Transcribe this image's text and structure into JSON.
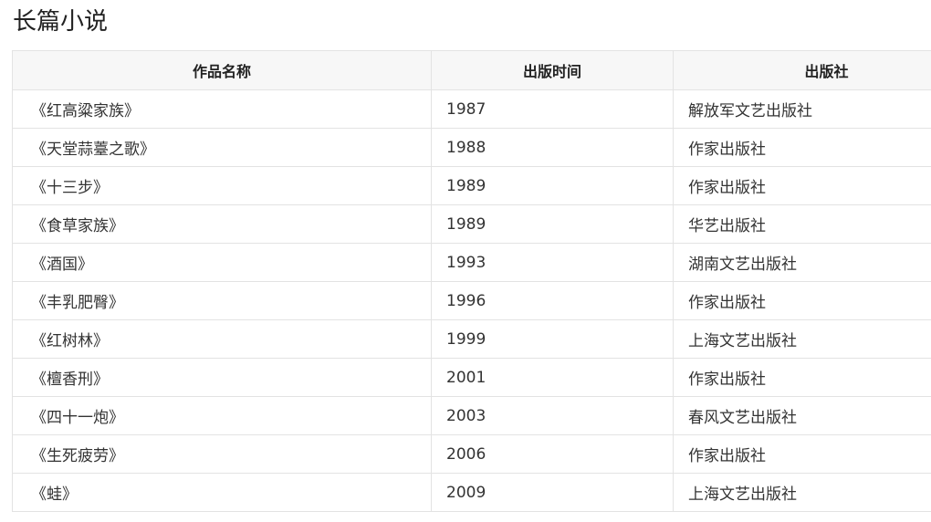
{
  "page": {
    "title": "长篇小说"
  },
  "table": {
    "headers": [
      "作品名称",
      "出版时间",
      "出版社"
    ],
    "rows": [
      [
        "《红高粱家族》",
        "1987",
        "解放军文艺出版社"
      ],
      [
        "《天堂蒜薹之歌》",
        "1988",
        "作家出版社"
      ],
      [
        "《十三步》",
        "1989",
        "作家出版社"
      ],
      [
        "《食草家族》",
        "1989",
        "华艺出版社"
      ],
      [
        "《酒国》",
        "1993",
        "湖南文艺出版社"
      ],
      [
        "《丰乳肥臀》",
        "1996",
        "作家出版社"
      ],
      [
        "《红树林》",
        "1999",
        "上海文艺出版社"
      ],
      [
        "《檀香刑》",
        "2001",
        "作家出版社"
      ],
      [
        "《四十一炮》",
        "2003",
        "春风文艺出版社"
      ],
      [
        "《生死疲劳》",
        "2006",
        "作家出版社"
      ],
      [
        "《蛙》",
        "2009",
        "上海文艺出版社"
      ]
    ]
  }
}
